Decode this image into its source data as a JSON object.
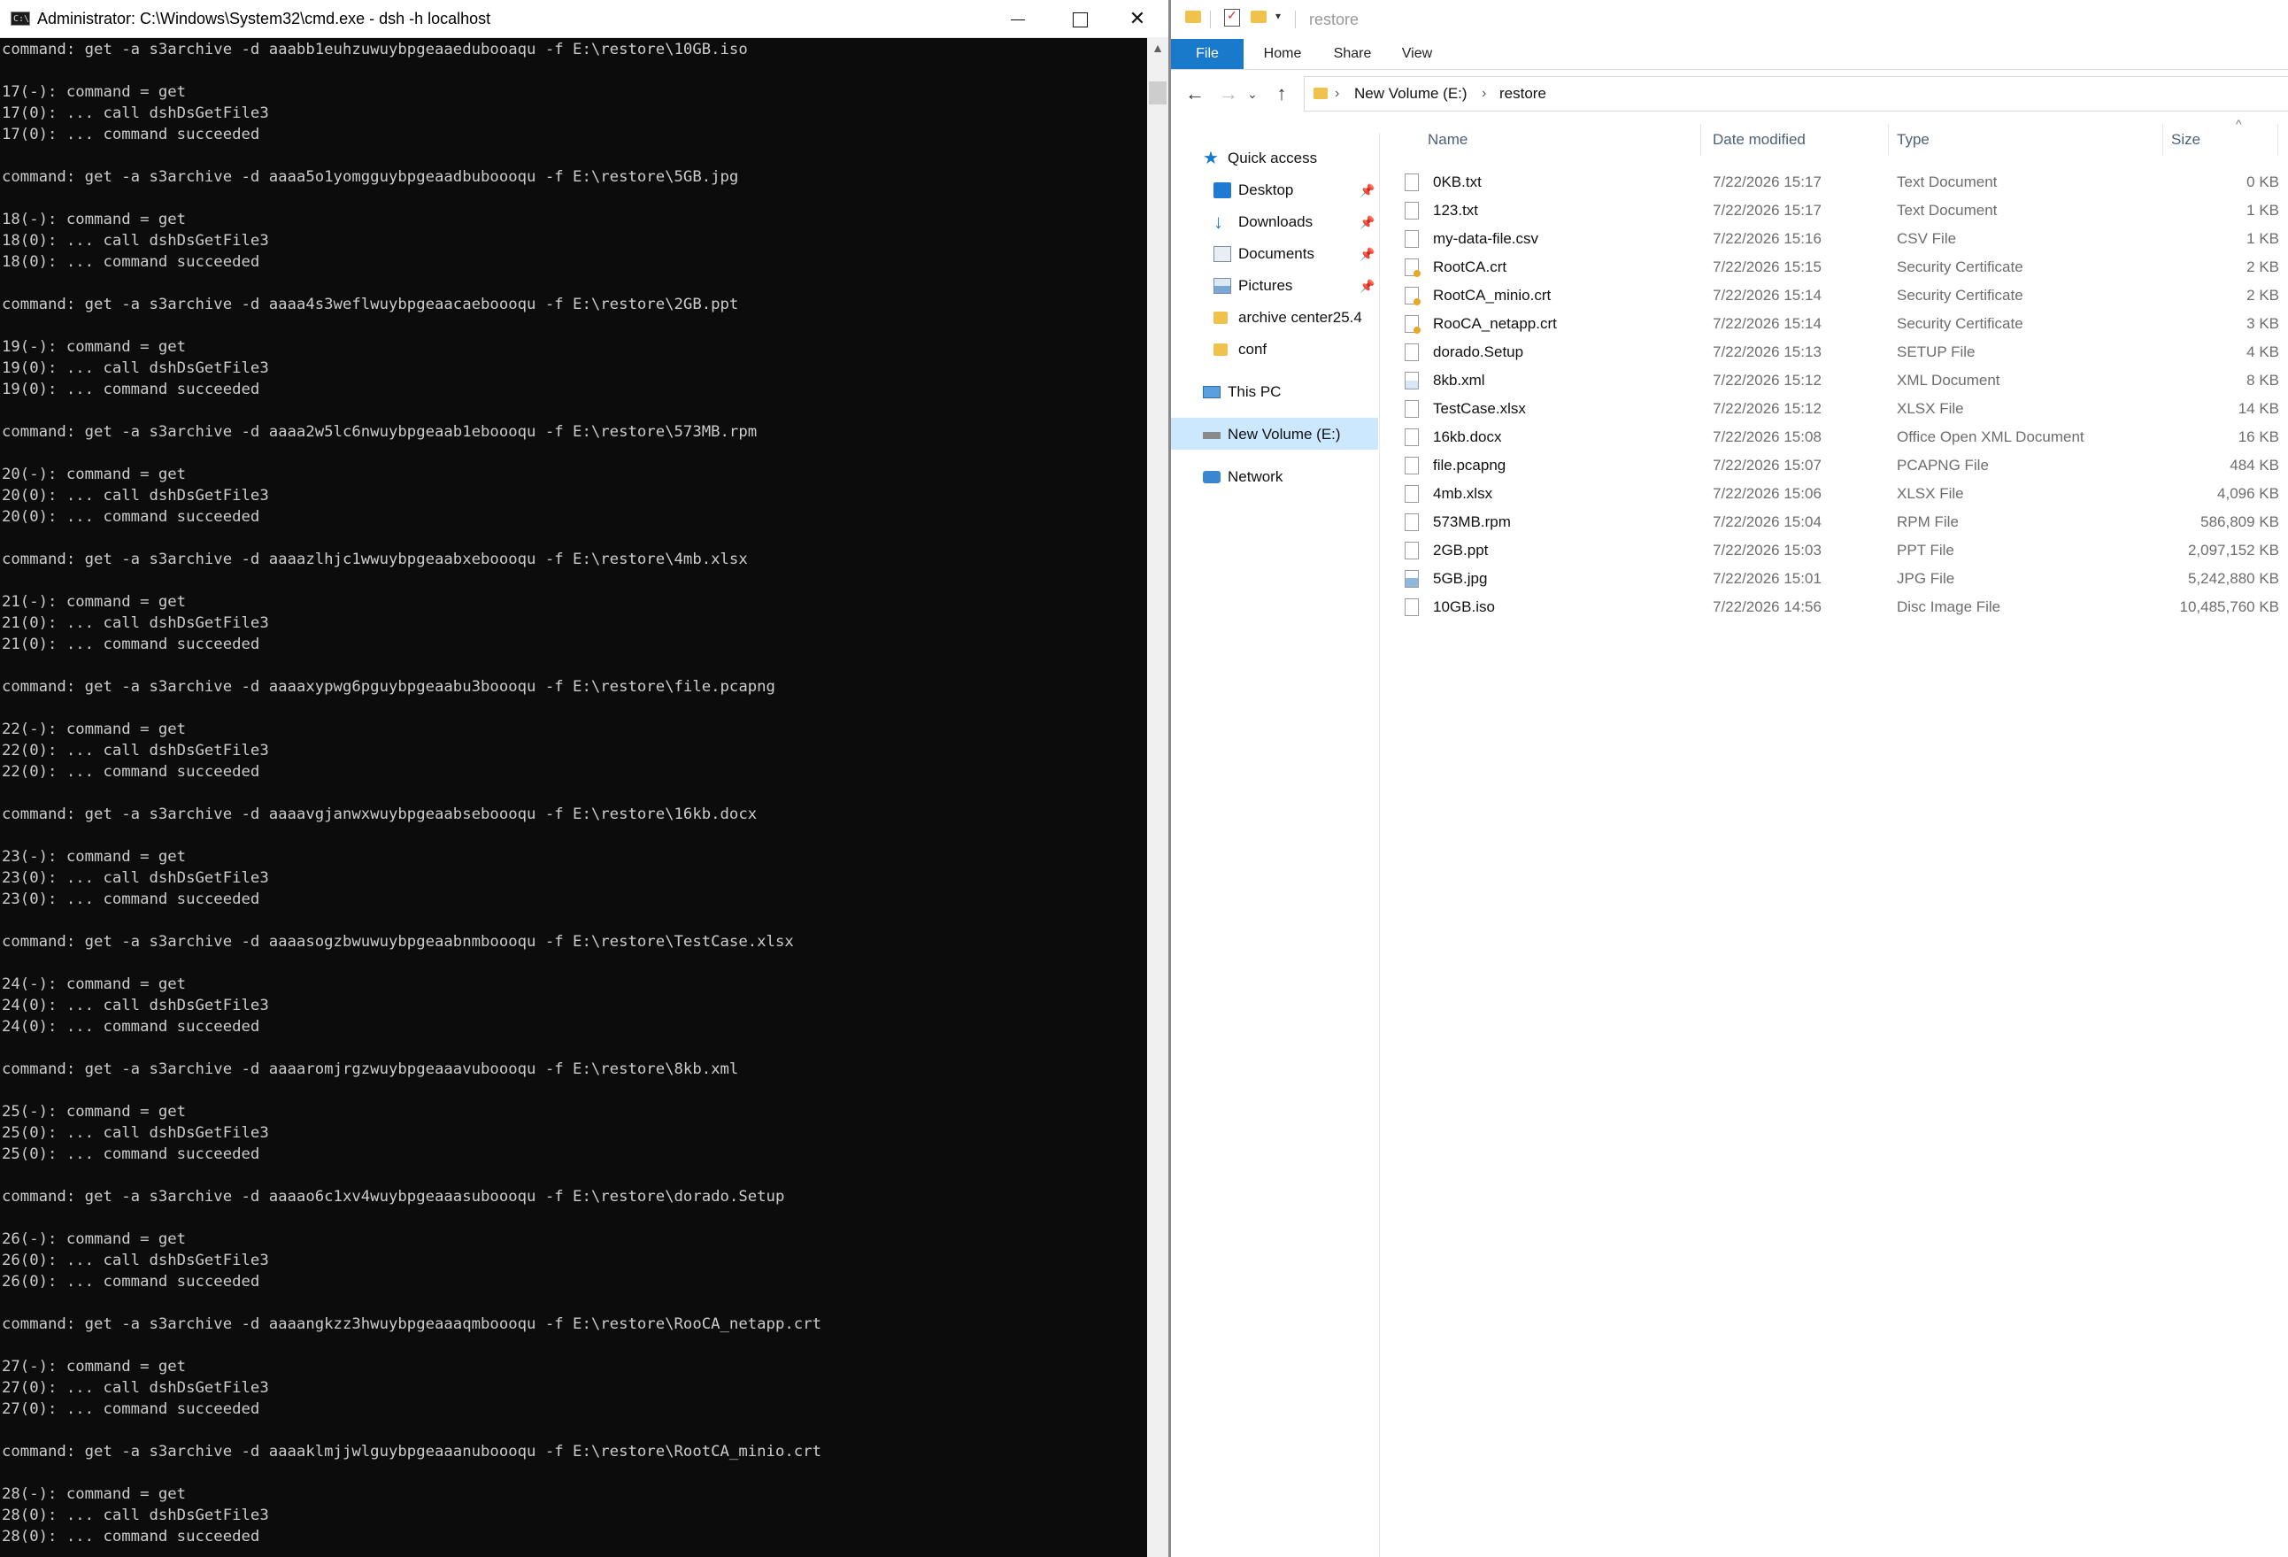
{
  "cmd": {
    "title": "Administrator: C:\\Windows\\System32\\cmd.exe - dsh  -h localhost",
    "icon_text": "C:\\.",
    "lines": [
      "command: get -a s3archive -d aaabb1euhzuwuybpgeaaedubooaqu -f E:\\restore\\10GB.iso",
      "",
      "17(-): command = get",
      "17(0): ... call dshDsGetFile3",
      "17(0): ... command succeeded",
      "",
      "command: get -a s3archive -d aaaa5o1yomgguybpgeaadbuboooqu -f E:\\restore\\5GB.jpg",
      "",
      "18(-): command = get",
      "18(0): ... call dshDsGetFile3",
      "18(0): ... command succeeded",
      "",
      "command: get -a s3archive -d aaaa4s3weflwuybpgeaacaeboooqu -f E:\\restore\\2GB.ppt",
      "",
      "19(-): command = get",
      "19(0): ... call dshDsGetFile3",
      "19(0): ... command succeeded",
      "",
      "command: get -a s3archive -d aaaa2w5lc6nwuybpgeaab1eboooqu -f E:\\restore\\573MB.rpm",
      "",
      "20(-): command = get",
      "20(0): ... call dshDsGetFile3",
      "20(0): ... command succeeded",
      "",
      "command: get -a s3archive -d aaaazlhjc1wwuybpgeaabxeboooqu -f E:\\restore\\4mb.xlsx",
      "",
      "21(-): command = get",
      "21(0): ... call dshDsGetFile3",
      "21(0): ... command succeeded",
      "",
      "command: get -a s3archive -d aaaaxypwg6pguybpgeaabu3boooqu -f E:\\restore\\file.pcapng",
      "",
      "22(-): command = get",
      "22(0): ... call dshDsGetFile3",
      "22(0): ... command succeeded",
      "",
      "command: get -a s3archive -d aaaavgjanwxwuybpgeaabseboooqu -f E:\\restore\\16kb.docx",
      "",
      "23(-): command = get",
      "23(0): ... call dshDsGetFile3",
      "23(0): ... command succeeded",
      "",
      "command: get -a s3archive -d aaaasogzbwuwuybpgeaabnmboooqu -f E:\\restore\\TestCase.xlsx",
      "",
      "24(-): command = get",
      "24(0): ... call dshDsGetFile3",
      "24(0): ... command succeeded",
      "",
      "command: get -a s3archive -d aaaaromjrgzwuybpgeaaavuboooqu -f E:\\restore\\8kb.xml",
      "",
      "25(-): command = get",
      "25(0): ... call dshDsGetFile3",
      "25(0): ... command succeeded",
      "",
      "command: get -a s3archive -d aaaao6c1xv4wuybpgeaaasuboooqu -f E:\\restore\\dorado.Setup",
      "",
      "26(-): command = get",
      "26(0): ... call dshDsGetFile3",
      "26(0): ... command succeeded",
      "",
      "command: get -a s3archive -d aaaangkzz3hwuybpgeaaaqmboooqu -f E:\\restore\\RooCA_netapp.crt",
      "",
      "27(-): command = get",
      "27(0): ... call dshDsGetFile3",
      "27(0): ... command succeeded",
      "",
      "command: get -a s3archive -d aaaaklmjjwlguybpgeaaanuboooqu -f E:\\restore\\RootCA_minio.crt",
      "",
      "28(-): command = get",
      "28(0): ... call dshDsGetFile3",
      "28(0): ... command succeeded"
    ]
  },
  "explorer": {
    "title": "restore",
    "tabs": {
      "file": "File",
      "home": "Home",
      "share": "Share",
      "view": "View"
    },
    "breadcrumb": {
      "volume": "New Volume (E:)",
      "folder": "restore"
    },
    "nav": {
      "quick_access": "Quick access",
      "desktop": "Desktop",
      "downloads": "Downloads",
      "documents": "Documents",
      "pictures": "Pictures",
      "archive": "archive center25.4",
      "conf": "conf",
      "this_pc": "This PC",
      "new_volume": "New Volume (E:)",
      "network": "Network"
    },
    "columns": {
      "name": "Name",
      "date": "Date modified",
      "type": "Type",
      "size": "Size"
    },
    "files": [
      {
        "name": "0KB.txt",
        "date": "7/22/2026 15:17",
        "type": "Text Document",
        "size": "0 KB",
        "icon": "text-file-icon"
      },
      {
        "name": "123.txt",
        "date": "7/22/2026 15:17",
        "type": "Text Document",
        "size": "1 KB",
        "icon": "text-file-icon"
      },
      {
        "name": "my-data-file.csv",
        "date": "7/22/2026 15:16",
        "type": "CSV File",
        "size": "1 KB",
        "icon": "file-icon"
      },
      {
        "name": "RootCA.crt",
        "date": "7/22/2026 15:15",
        "type": "Security Certificate",
        "size": "2 KB",
        "icon": "certificate-icon"
      },
      {
        "name": "RootCA_minio.crt",
        "date": "7/22/2026 15:14",
        "type": "Security Certificate",
        "size": "2 KB",
        "icon": "certificate-icon"
      },
      {
        "name": "RooCA_netapp.crt",
        "date": "7/22/2026 15:14",
        "type": "Security Certificate",
        "size": "3 KB",
        "icon": "certificate-icon"
      },
      {
        "name": "dorado.Setup",
        "date": "7/22/2026 15:13",
        "type": "SETUP File",
        "size": "4 KB",
        "icon": "file-icon"
      },
      {
        "name": "8kb.xml",
        "date": "7/22/2026 15:12",
        "type": "XML Document",
        "size": "8 KB",
        "icon": "xml-file-icon"
      },
      {
        "name": "TestCase.xlsx",
        "date": "7/22/2026 15:12",
        "type": "XLSX File",
        "size": "14 KB",
        "icon": "file-icon"
      },
      {
        "name": "16kb.docx",
        "date": "7/22/2026 15:08",
        "type": "Office Open XML Document",
        "size": "16 KB",
        "icon": "document-file-icon"
      },
      {
        "name": "file.pcapng",
        "date": "7/22/2026 15:07",
        "type": "PCAPNG File",
        "size": "484 KB",
        "icon": "file-icon"
      },
      {
        "name": "4mb.xlsx",
        "date": "7/22/2026 15:06",
        "type": "XLSX File",
        "size": "4,096 KB",
        "icon": "file-icon"
      },
      {
        "name": "573MB.rpm",
        "date": "7/22/2026 15:04",
        "type": "RPM File",
        "size": "586,809 KB",
        "icon": "file-icon"
      },
      {
        "name": "2GB.ppt",
        "date": "7/22/2026 15:03",
        "type": "PPT File",
        "size": "2,097,152 KB",
        "icon": "file-icon"
      },
      {
        "name": "5GB.jpg",
        "date": "7/22/2026 15:01",
        "type": "JPG File",
        "size": "5,242,880 KB",
        "icon": "image-file-icon"
      },
      {
        "name": "10GB.iso",
        "date": "7/22/2026 14:56",
        "type": "Disc Image File",
        "size": "10,485,760 KB",
        "icon": "disc-image-icon"
      }
    ]
  },
  "colors": {
    "console_bg": "#0c0c0c",
    "console_text": "#cccccc",
    "ribbon_file_tab": "#1979ca",
    "selected_nav": "#cce8ff",
    "folder_yellow": "#f0c24b"
  }
}
